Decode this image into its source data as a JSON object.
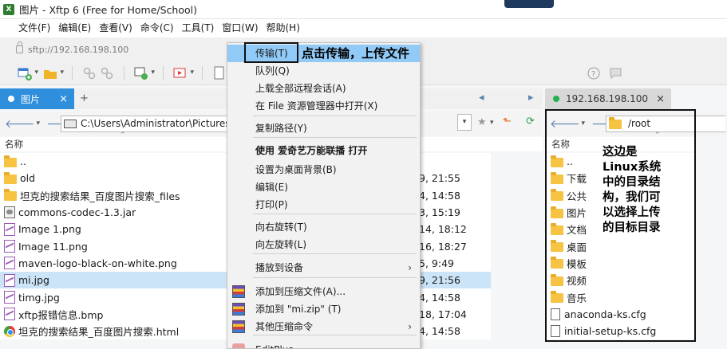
{
  "window": {
    "title": "图片 - Xftp 6 (Free for Home/School)"
  },
  "menubar": {
    "items": [
      "文件(F)",
      "编辑(E)",
      "查看(V)",
      "命令(C)",
      "工具(T)",
      "窗口(W)",
      "帮助(H)"
    ]
  },
  "address": {
    "value": "sftp://192.168.198.100"
  },
  "tabs": {
    "local": {
      "label": "图片",
      "close": "×"
    },
    "remote": {
      "label": "192.168.198.100",
      "close": "×"
    }
  },
  "local": {
    "path": "C:\\Users\\Administrator\\Pictures",
    "header_name": "名称",
    "files": [
      {
        "name": "..",
        "type": "folder",
        "date": ""
      },
      {
        "name": "old",
        "type": "folder",
        "date": "9, 21:55"
      },
      {
        "name": "坦克的搜索结果_百度图片搜索_files",
        "type": "folder",
        "date": "4, 14:58"
      },
      {
        "name": "commons-codec-1.3.jar",
        "type": "jar",
        "date": "3, 15:19"
      },
      {
        "name": "Image 1.png",
        "type": "img",
        "date": "14, 18:12"
      },
      {
        "name": "Image 11.png",
        "type": "img",
        "date": "16, 18:27"
      },
      {
        "name": "maven-logo-black-on-white.png",
        "type": "img",
        "date": "5, 9:49"
      },
      {
        "name": "mi.jpg",
        "type": "img",
        "date": "9, 21:56",
        "selected": true
      },
      {
        "name": "timg.jpg",
        "type": "img",
        "date": "4, 14:58"
      },
      {
        "name": "xftp报错信息.bmp",
        "type": "img",
        "date": "18, 17:04"
      },
      {
        "name": "坦克的搜索结果_百度图片搜索.html",
        "type": "html",
        "date": "4, 14:58"
      }
    ]
  },
  "remote": {
    "path": "/root",
    "header_name": "名称",
    "files": [
      {
        "name": "..",
        "type": "folder"
      },
      {
        "name": "下载",
        "type": "folder"
      },
      {
        "name": "公共",
        "type": "folder"
      },
      {
        "name": "图片",
        "type": "folder"
      },
      {
        "name": "文档",
        "type": "folder"
      },
      {
        "name": "桌面",
        "type": "folder"
      },
      {
        "name": "模板",
        "type": "folder"
      },
      {
        "name": "视频",
        "type": "folder"
      },
      {
        "name": "音乐",
        "type": "folder"
      },
      {
        "name": "anaconda-ks.cfg",
        "type": "doc"
      },
      {
        "name": "initial-setup-ks.cfg",
        "type": "doc"
      }
    ]
  },
  "context_menu": {
    "items": [
      {
        "label": "传输(T)",
        "highlighted": true
      },
      {
        "label": "队列(Q)"
      },
      {
        "label": "上载全部远程会话(A)"
      },
      {
        "label": "在 File 资源管理器中打开(X)"
      },
      {
        "label": "复制路径(Y)"
      },
      {
        "label": "使用 爱奇艺万能联播 打开",
        "bold": true
      },
      {
        "label": "设置为桌面背景(B)"
      },
      {
        "label": "编辑(E)"
      },
      {
        "label": "打印(P)"
      },
      {
        "label": "向右旋转(T)"
      },
      {
        "label": "向左旋转(L)"
      },
      {
        "label": "播放到设备",
        "submenu": true
      },
      {
        "label": "添加到压缩文件(A)...",
        "icon": "archive"
      },
      {
        "label": "添加到 \"mi.zip\" (T)",
        "icon": "archive"
      },
      {
        "label": "其他压缩命令",
        "icon": "archive",
        "submenu": true
      },
      {
        "label": "EditPlus",
        "icon": "paint"
      }
    ],
    "submenu_arrow": "›"
  },
  "annotations": {
    "callout": "点击传输，上传文件",
    "remote_note": "这边是Linux系统中的目录结构，我们可以选择上传的目标目录"
  },
  "colors": {
    "tab_active": "#2f8fdc",
    "tab_dot_local": "#ffffff",
    "tab_dot_remote": "#22b14c",
    "menu_highlight": "#91c9f7",
    "selection": "#cce4f7",
    "folder": "#f6c343"
  }
}
